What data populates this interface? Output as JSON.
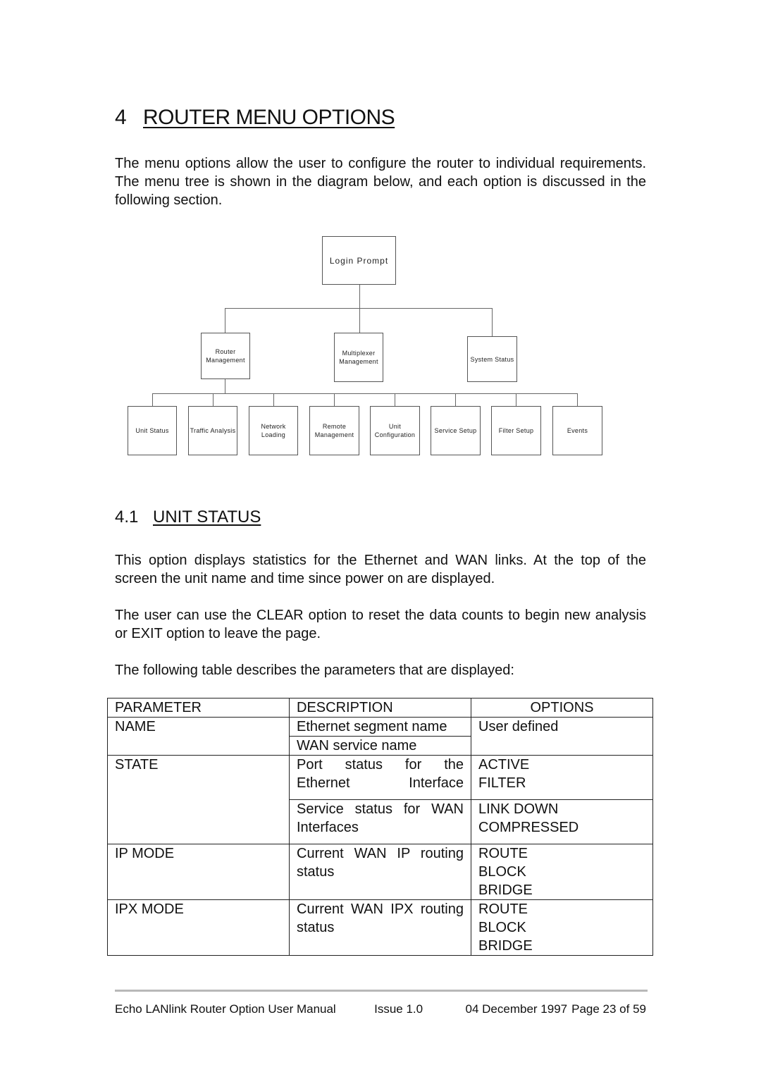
{
  "section": {
    "number": "4",
    "title": "ROUTER MENU OPTIONS",
    "intro": "The menu options allow the user to configure the router to individual requirements.  The menu tree is shown in the diagram below, and each option is discussed in the following section."
  },
  "diagram": {
    "root": "Login Prompt",
    "level1": [
      "Router Management",
      "Multiplexer Management",
      "System Status"
    ],
    "level2_parent": "Router Management",
    "level2": [
      "Unit Status",
      "Traffic Analysis",
      "Network Loading",
      "Remote Management",
      "Unit Configuration",
      "Service Setup",
      "Filter Setup",
      "Events"
    ]
  },
  "subsection": {
    "number": "4.1",
    "title": "UNIT STATUS",
    "paragraphs": [
      "This option displays statistics for the Ethernet and WAN links. At the top of the screen the unit name and time since power on are displayed.",
      "The user can use the CLEAR option to reset the data counts to begin new analysis or EXIT option to leave the page.",
      "The following table describes the parameters that are displayed:"
    ]
  },
  "table": {
    "headers": [
      "PARAMETER",
      "DESCRIPTION",
      "OPTIONS"
    ],
    "rows": [
      {
        "parameter": "NAME",
        "entries": [
          {
            "description": "Ethernet segment name",
            "options": [
              "User defined"
            ]
          },
          {
            "description": "WAN service name",
            "options": []
          }
        ]
      },
      {
        "parameter": "STATE",
        "entries": [
          {
            "description": "Port status for the Ethernet Interface",
            "options": [
              "ACTIVE",
              "FILTER"
            ]
          },
          {
            "description": "Service status for WAN Interfaces",
            "options": [
              "LINK DOWN",
              "COMPRESSED"
            ]
          }
        ]
      },
      {
        "parameter": "IP MODE",
        "entries": [
          {
            "description": "Current WAN IP routing status",
            "options": [
              "ROUTE",
              "BLOCK",
              "BRIDGE"
            ]
          }
        ]
      },
      {
        "parameter": "IPX MODE",
        "entries": [
          {
            "description": "Current WAN IPX routing status",
            "options": [
              "ROUTE",
              "BLOCK",
              "BRIDGE"
            ]
          }
        ]
      }
    ]
  },
  "footer": {
    "manual_title": "Echo LANlink Router Option User Manual",
    "issue": "Issue 1.0",
    "date": "04 December 1997",
    "page": "Page 23 of 59"
  }
}
